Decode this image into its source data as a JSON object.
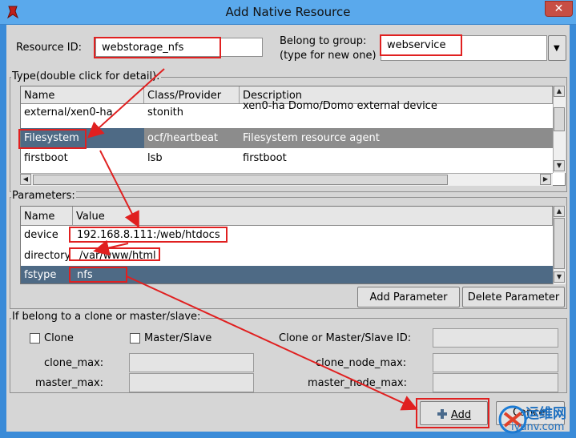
{
  "window": {
    "title": "Add Native Resource",
    "close_glyph": "✕"
  },
  "resource_id": {
    "label": "Resource ID:",
    "value": "webstorage_nfs"
  },
  "group": {
    "label_line1": "Belong to group:",
    "label_line2": "(type for new one)",
    "value": "webservice"
  },
  "type_section": {
    "label": "Type(double click for detail):",
    "columns": [
      "Name",
      "Class/Provider",
      "Description"
    ],
    "rows": [
      {
        "name": "external/xen0-ha",
        "provider": "stonith",
        "description": "xen0-ha Domo/Domo external device"
      },
      {
        "name": "Filesystem",
        "provider": "ocf/heartbeat",
        "description": "Filesystem resource agent"
      },
      {
        "name": "firstboot",
        "provider": "lsb",
        "description": "firstboot"
      }
    ]
  },
  "params_section": {
    "label": "Parameters:",
    "columns": [
      "Name",
      "Value"
    ],
    "rows": [
      {
        "name": "device",
        "value": "192.168.8.111:/web/htdocs"
      },
      {
        "name": "directory",
        "value": "/var/www/html"
      },
      {
        "name": "fstype",
        "value": "nfs"
      }
    ],
    "add_button": "Add Parameter",
    "delete_button": "Delete Parameter"
  },
  "clone_section": {
    "label": "If belong to a clone or master/slave:",
    "clone_label": "Clone",
    "master_slave_label": "Master/Slave",
    "clone_id_label": "Clone or Master/Slave ID:",
    "clone_max_label": "clone_max:",
    "clone_node_max_label": "clone_node_max:",
    "master_max_label": "master_max:",
    "master_node_max_label": "master_node_max:"
  },
  "buttons": {
    "add": "Add",
    "cancel": "Cancel"
  },
  "colors": {
    "annotation_red": "#e02020",
    "selection": "#4e6a85",
    "title_bar": "#5aa9ec"
  },
  "watermark": {
    "site": "iyunv.com",
    "brand": "运维网"
  }
}
